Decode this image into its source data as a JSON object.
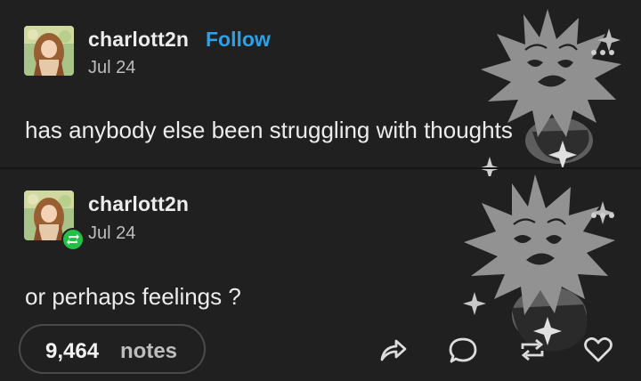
{
  "post1": {
    "username": "charlott2n",
    "follow_label": "Follow",
    "date": "Jul 24",
    "text": "has anybody else been struggling with thoughts"
  },
  "post2": {
    "username": "charlott2n",
    "date": "Jul 24",
    "text": "or perhaps feelings ?"
  },
  "footer": {
    "notes_count": "9,464",
    "notes_label": "notes"
  },
  "icons": {
    "more": "meatball-menu-icon",
    "share": "share-arrow-icon",
    "reply": "reply-bubble-icon",
    "reblog": "reblog-icon",
    "like": "heart-icon"
  },
  "colors": {
    "background": "#202020",
    "follow": "#2aa1e8",
    "reblog_badge": "#23c048",
    "text": "#ececec",
    "muted": "#bdbdbd"
  }
}
